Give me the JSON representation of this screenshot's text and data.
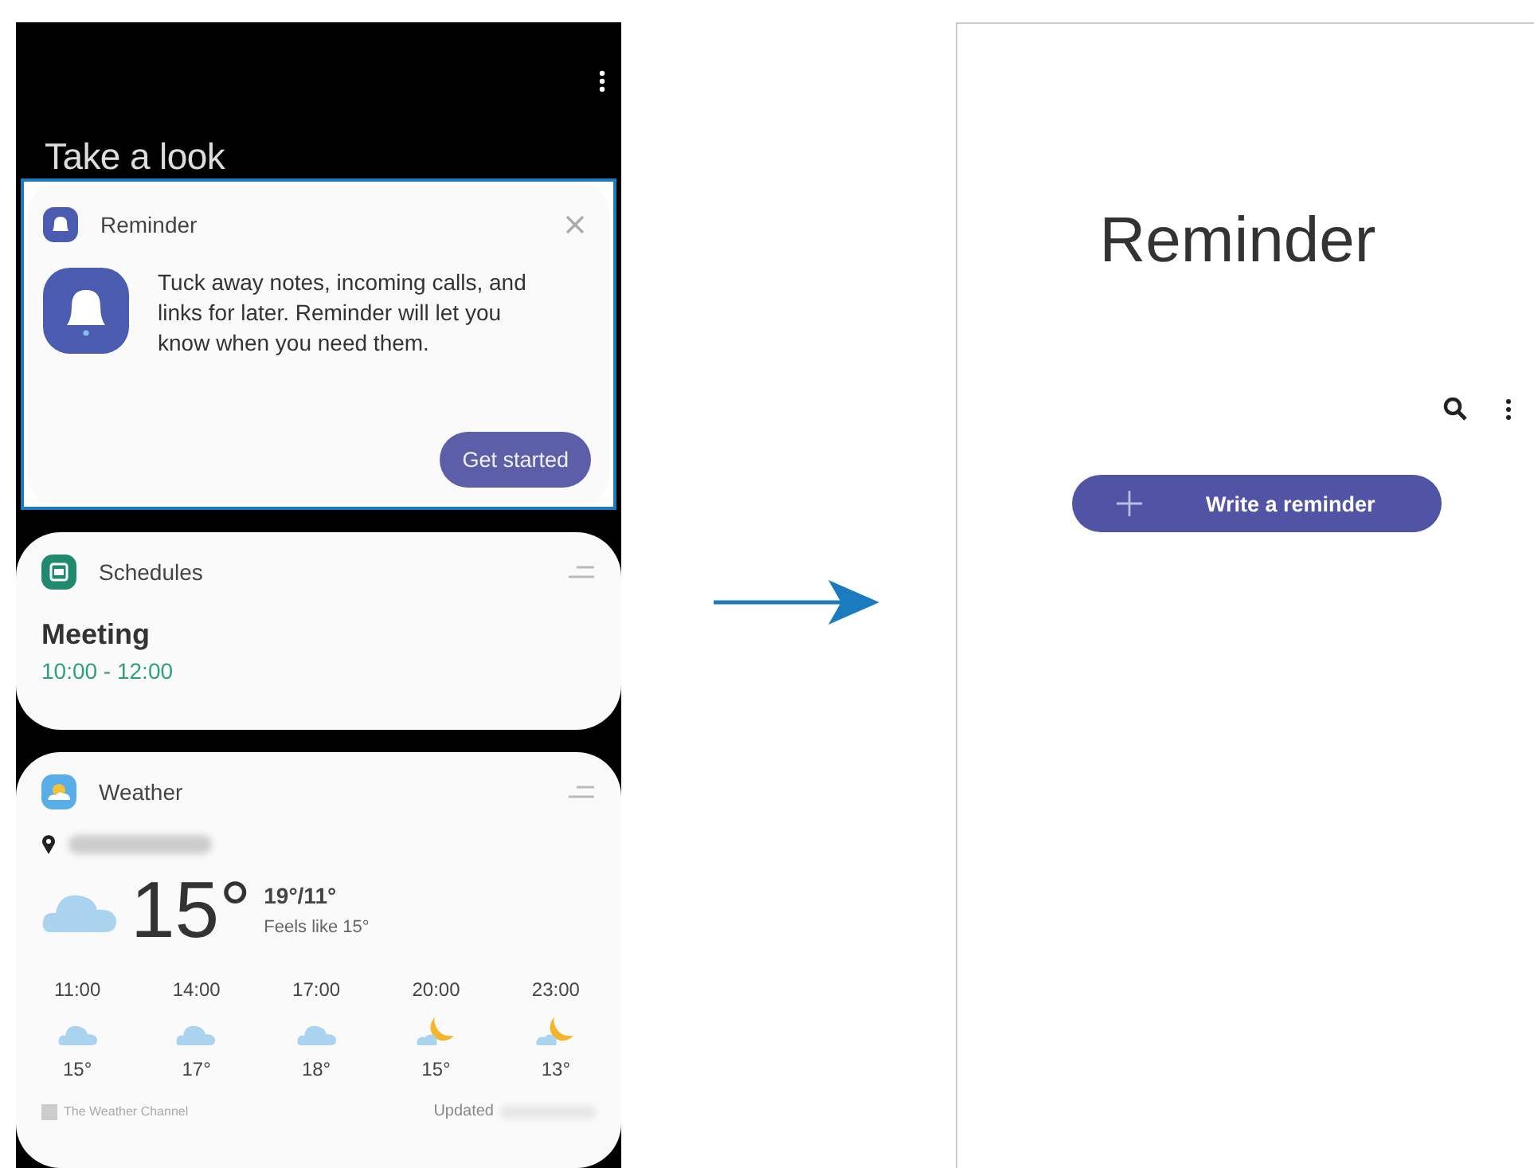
{
  "left_screen": {
    "title": "Take a look",
    "cards": [
      {
        "kind": "promo",
        "title": "Reminder",
        "highlighted": true,
        "body": "Tuck away notes, incoming calls, and links for later. Reminder will let you know when you need them.",
        "button": "Get started"
      },
      {
        "kind": "schedule",
        "title": "Schedules",
        "event": "Meeting",
        "time": "10:00 - 12:00"
      },
      {
        "kind": "weather",
        "title": "Weather",
        "temperature": "15°",
        "high_low": "19°/11°",
        "feels_like": "Feels like 15°",
        "source": "The Weather Channel",
        "updated": "Updated",
        "hourly": [
          {
            "time": "11:00",
            "kind": "cloudy",
            "temp": "15°"
          },
          {
            "time": "14:00",
            "kind": "cloudy",
            "temp": "17°"
          },
          {
            "time": "17:00",
            "kind": "cloudy",
            "temp": "18°"
          },
          {
            "time": "20:00",
            "kind": "night",
            "temp": "15°"
          },
          {
            "time": "23:00",
            "kind": "night",
            "temp": "13°"
          }
        ]
      }
    ]
  },
  "right_screen": {
    "title": "Reminder",
    "button": "Write a reminder"
  }
}
